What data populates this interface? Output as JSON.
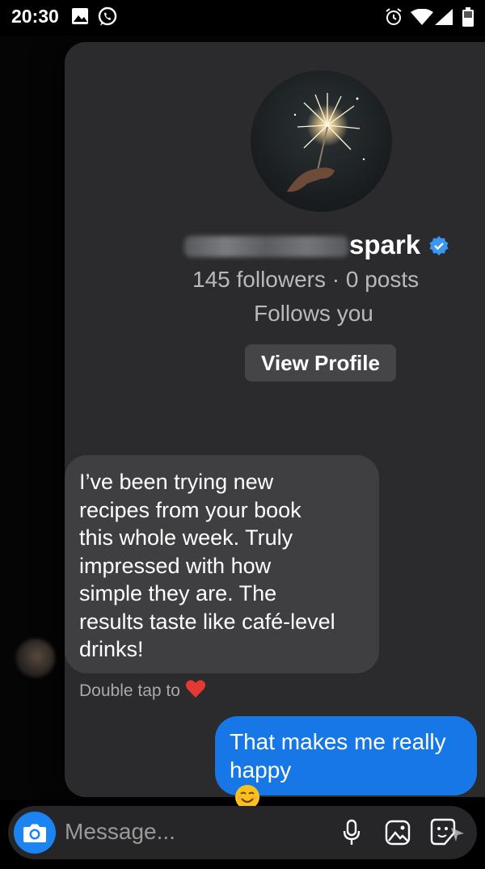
{
  "status_bar": {
    "time": "20:30"
  },
  "profile": {
    "username_suffix": "spark",
    "stats": "145 followers · 0 posts",
    "follows_you": "Follows you",
    "view_profile_label": "View Profile"
  },
  "messages": {
    "incoming": {
      "lines": [
        "I’ve been trying new",
        "recipes from your book",
        "this whole week. Truly",
        "impressed with how",
        "simple they are. The",
        "results taste like café-level",
        "drinks!"
      ]
    },
    "double_tap_hint": "Double tap to",
    "outgoing": {
      "line1": "That makes me really",
      "line2": "happy"
    }
  },
  "composer": {
    "placeholder": "Message..."
  },
  "colors": {
    "accent": "#1877e6",
    "card": "#2b2b2d",
    "incoming_bubble": "#3f3f41"
  }
}
